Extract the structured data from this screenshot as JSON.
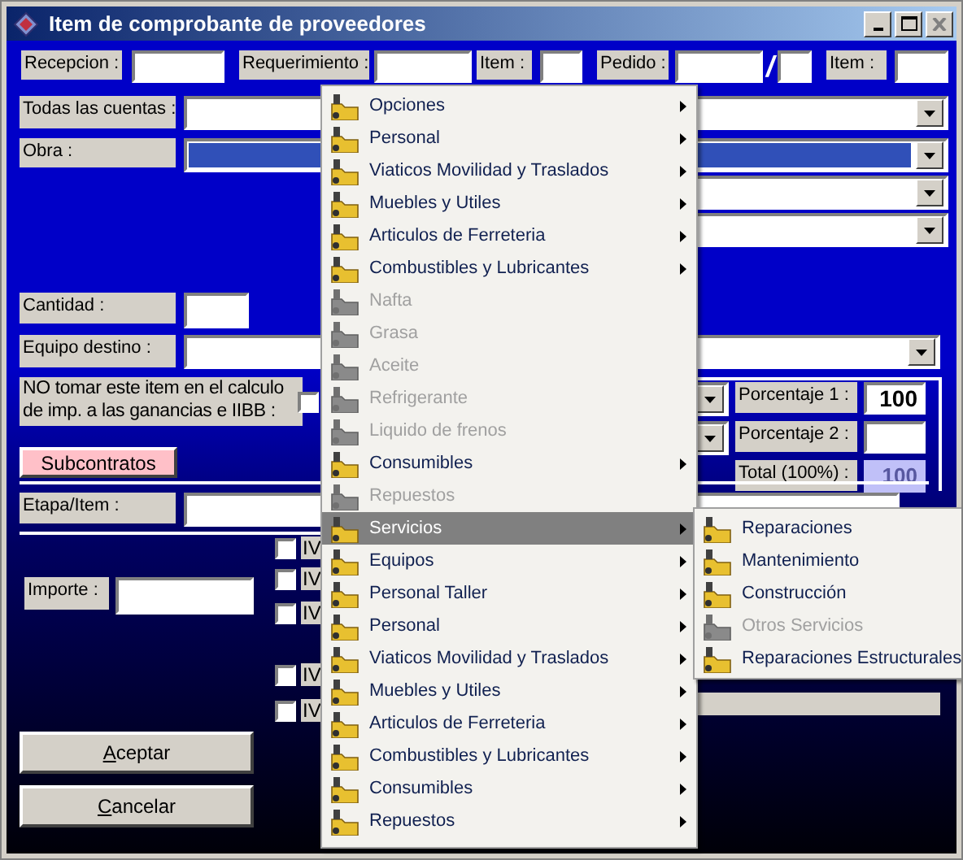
{
  "window": {
    "title": "Item de comprobante de proveedores"
  },
  "form": {
    "recepcion_label": "Recepcion :",
    "requerimiento_label": "Requerimiento :",
    "item_label": "Item :",
    "pedido_label": "Pedido :",
    "pedido_separator": "/",
    "pedido_item_label": "Item :",
    "todas_las_cuentas_label": "Todas las cuentas :",
    "obra_label": "Obra :",
    "cantidad_label": "Cantidad :",
    "equipo_destino_label": "Equipo destino :",
    "no_tomar_label": "NO tomar este item en el calculo de imp. a las ganancias e IIBB :",
    "no_tomar_checked": false,
    "subcontratos_button": "Subcontratos",
    "etapa_item_label": "Etapa/Item :",
    "importe_label": "Importe :",
    "porcentaje_1_label": "Porcentaje 1 :",
    "porcentaje_1_value": "100",
    "porcentaje_2_label": "Porcentaje 2 :",
    "total_label": "Total (100%) :",
    "total_value": "100",
    "iva_checkboxes": [
      {
        "label": "IV",
        "checked": false
      },
      {
        "label": "IV",
        "checked": false
      },
      {
        "label": "IV",
        "checked": false
      },
      {
        "label": "IV",
        "checked": false
      },
      {
        "label": "IV",
        "checked": false
      }
    ]
  },
  "buttons": [
    {
      "label": "Aceptar"
    },
    {
      "label": "Cancelar"
    }
  ],
  "menu": {
    "items": [
      {
        "label": "Opciones",
        "disabled": false,
        "submenu": true,
        "selected": false
      },
      {
        "label": "Personal",
        "disabled": false,
        "submenu": true,
        "selected": false
      },
      {
        "label": "Viaticos Movilidad y Traslados",
        "disabled": false,
        "submenu": true,
        "selected": false
      },
      {
        "label": "Muebles y Utiles",
        "disabled": false,
        "submenu": true,
        "selected": false
      },
      {
        "label": "Articulos de Ferreteria",
        "disabled": false,
        "submenu": true,
        "selected": false
      },
      {
        "label": "Combustibles y Lubricantes",
        "disabled": false,
        "submenu": true,
        "selected": false
      },
      {
        "label": "Nafta",
        "disabled": true,
        "submenu": false,
        "selected": false
      },
      {
        "label": "Grasa",
        "disabled": true,
        "submenu": false,
        "selected": false
      },
      {
        "label": "Aceite",
        "disabled": true,
        "submenu": false,
        "selected": false
      },
      {
        "label": "Refrigerante",
        "disabled": true,
        "submenu": false,
        "selected": false
      },
      {
        "label": "Liquido de frenos",
        "disabled": true,
        "submenu": false,
        "selected": false
      },
      {
        "label": "Consumibles",
        "disabled": false,
        "submenu": true,
        "selected": false
      },
      {
        "label": "Repuestos",
        "disabled": true,
        "submenu": false,
        "selected": false
      },
      {
        "label": "Servicios",
        "disabled": false,
        "submenu": true,
        "selected": true
      },
      {
        "label": "Equipos",
        "disabled": false,
        "submenu": true,
        "selected": false
      },
      {
        "label": "Personal Taller",
        "disabled": false,
        "submenu": true,
        "selected": false
      },
      {
        "label": "Personal",
        "disabled": false,
        "submenu": true,
        "selected": false
      },
      {
        "label": "Viaticos Movilidad y Traslados",
        "disabled": false,
        "submenu": true,
        "selected": false
      },
      {
        "label": "Muebles y Utiles",
        "disabled": false,
        "submenu": true,
        "selected": false
      },
      {
        "label": "Articulos de Ferreteria",
        "disabled": false,
        "submenu": true,
        "selected": false
      },
      {
        "label": "Combustibles y Lubricantes",
        "disabled": false,
        "submenu": true,
        "selected": false
      },
      {
        "label": "Consumibles",
        "disabled": false,
        "submenu": true,
        "selected": false
      },
      {
        "label": "Repuestos",
        "disabled": false,
        "submenu": true,
        "selected": false
      }
    ]
  },
  "submenu": {
    "items": [
      {
        "label": "Reparaciones",
        "disabled": false
      },
      {
        "label": "Mantenimiento",
        "disabled": false
      },
      {
        "label": "Construcción",
        "disabled": false
      },
      {
        "label": "Otros Servicios",
        "disabled": true
      },
      {
        "label": "Reparaciones Estructurales",
        "disabled": false
      }
    ]
  }
}
